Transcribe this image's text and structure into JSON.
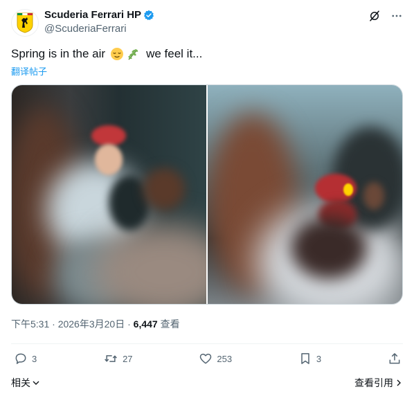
{
  "author": {
    "name": "Scuderia Ferrari HP",
    "handle": "@ScuderiaFerrari",
    "verified": true
  },
  "tweet": {
    "text_before": "Spring is in the air",
    "emojis": [
      "relieved-face",
      "herb"
    ],
    "text_after": "we feel it...",
    "translate_label": "翻译帖子"
  },
  "media": {
    "count": 2,
    "descriptions": [
      "photo-left",
      "photo-right"
    ]
  },
  "meta": {
    "time": "下午5:31",
    "dot": "·",
    "date": "2026年3月20日",
    "views_count": "6,447",
    "views_label": "查看"
  },
  "actions": {
    "replies": "3",
    "reposts": "27",
    "likes": "253",
    "bookmarks": "3"
  },
  "footer": {
    "related_label": "相关",
    "quotes_label": "查看引用"
  },
  "colors": {
    "accent": "#1d9bf0",
    "text": "#0f1419",
    "secondary": "#536471",
    "ferrari_yellow": "#ffd200"
  }
}
